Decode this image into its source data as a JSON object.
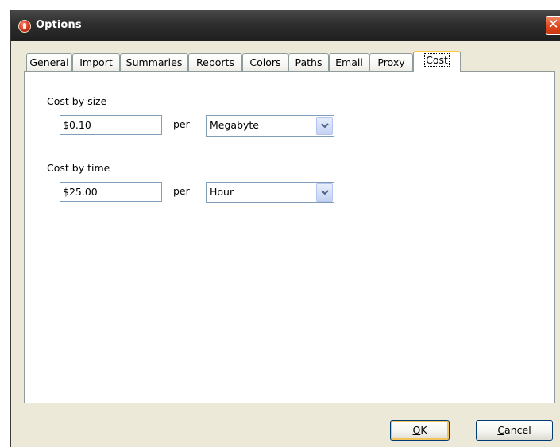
{
  "window": {
    "title": "Options",
    "close_glyph": "✕"
  },
  "tabs": [
    {
      "label": "General"
    },
    {
      "label": "Import"
    },
    {
      "label": "Summaries"
    },
    {
      "label": "Reports"
    },
    {
      "label": "Colors"
    },
    {
      "label": "Paths"
    },
    {
      "label": "Email"
    },
    {
      "label": "Proxy"
    },
    {
      "label": "Cost",
      "active": true
    }
  ],
  "cost": {
    "size": {
      "label": "Cost by size",
      "value": "$0.10",
      "per": "per",
      "unit": "Megabyte"
    },
    "time": {
      "label": "Cost by time",
      "value": "$25.00",
      "per": "per",
      "unit": "Hour"
    }
  },
  "buttons": {
    "ok": {
      "mnemonic": "O",
      "rest": "K"
    },
    "cancel": {
      "mnemonic": "C",
      "rest": "ancel"
    }
  },
  "colors": {
    "titlebar": "#2e2e2e",
    "dialog_bg": "#ece9d8",
    "active_tab_accent": "#ffc83c",
    "close_button": "#df4a20"
  },
  "icons": {
    "app": "app-icon",
    "close": "close-icon",
    "dropdown": "chevron-down-icon"
  }
}
